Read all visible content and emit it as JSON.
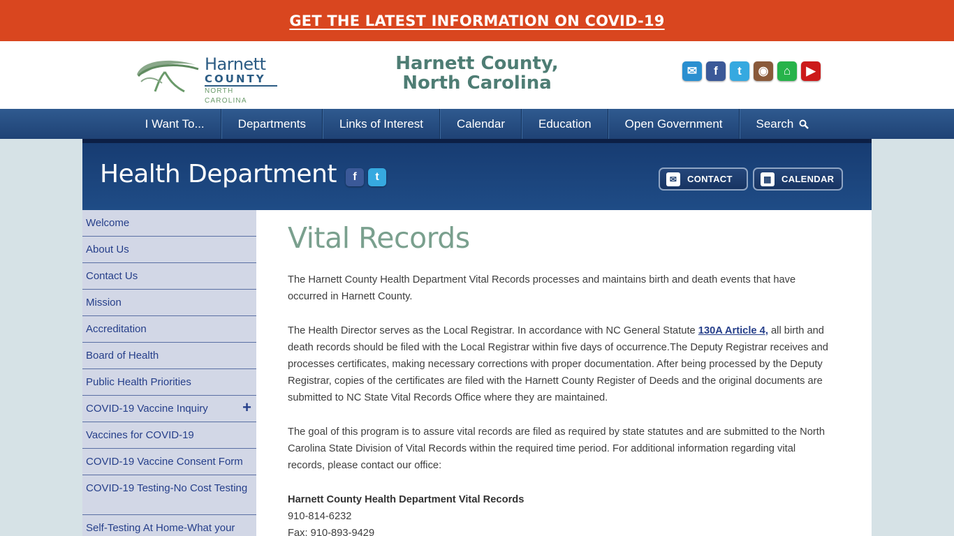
{
  "covid_banner": {
    "text": "GET THE LATEST INFORMATION ON COVID-19"
  },
  "header": {
    "logo": {
      "line1": "Harnett",
      "line2": "COUNTY",
      "line3": "NORTH CAROLINA"
    },
    "title_line1": "Harnett County,",
    "title_line2": "North Carolina",
    "social": [
      {
        "name": "email-icon",
        "glyph": "✉",
        "color": "#2a8fd0"
      },
      {
        "name": "facebook-icon",
        "glyph": "f",
        "color": "#3b5998"
      },
      {
        "name": "twitter-icon",
        "glyph": "t",
        "color": "#36a9e0"
      },
      {
        "name": "instagram-icon",
        "glyph": "◉",
        "color": "#8a5a3a"
      },
      {
        "name": "nextdoor-icon",
        "glyph": "⌂",
        "color": "#27b34a"
      },
      {
        "name": "youtube-icon",
        "glyph": "▶",
        "color": "#cc1b1b"
      }
    ]
  },
  "nav": {
    "items": [
      "I Want To...",
      "Departments",
      "Links of Interest",
      "Calendar",
      "Education",
      "Open Government",
      "Search"
    ]
  },
  "dept": {
    "title": "Health Department",
    "contact_label": "CONTACT",
    "calendar_label": "CALENDAR"
  },
  "sidebar": {
    "items": [
      "Welcome",
      "About Us",
      "Contact Us",
      "Mission",
      "Accreditation",
      "Board of Health",
      "Public Health Priorities",
      "COVID-19 Vaccine Inquiry",
      "Vaccines for COVID-19",
      "COVID-19 Vaccine Consent Form",
      "COVID-19 Testing-No Cost Testing",
      "Self-Testing At Home-What your"
    ]
  },
  "content": {
    "title": "Vital Records",
    "p1": "The Harnett County Health Department Vital Records processes and maintains birth and death events that have occurred in Harnett County.",
    "p2_before": "The Health Director serves as the Local Registrar. In accordance with NC General Statute ",
    "p2_link": "130A Article 4,",
    "p2_after": " all birth and death records should be filed with the Local Registrar within five days of occurrence.The Deputy Registrar receives and processes certificates, making necessary corrections with proper documentation. After being processed by the Deputy Registrar, copies of the certificates are filed with the Harnett County Register of Deeds and the original documents are submitted to NC State Vital Records Office where they are maintained.",
    "p3": "The goal of this program is to assure vital records are filed as required by state statutes and are submitted to the North Carolina State Division of Vital Records within the required time period. For additional information regarding vital records, please contact our office:",
    "contact_name": "Harnett County Health Department Vital Records",
    "phone": "910-814-6232",
    "fax": "Fax: 910-893-9429"
  }
}
